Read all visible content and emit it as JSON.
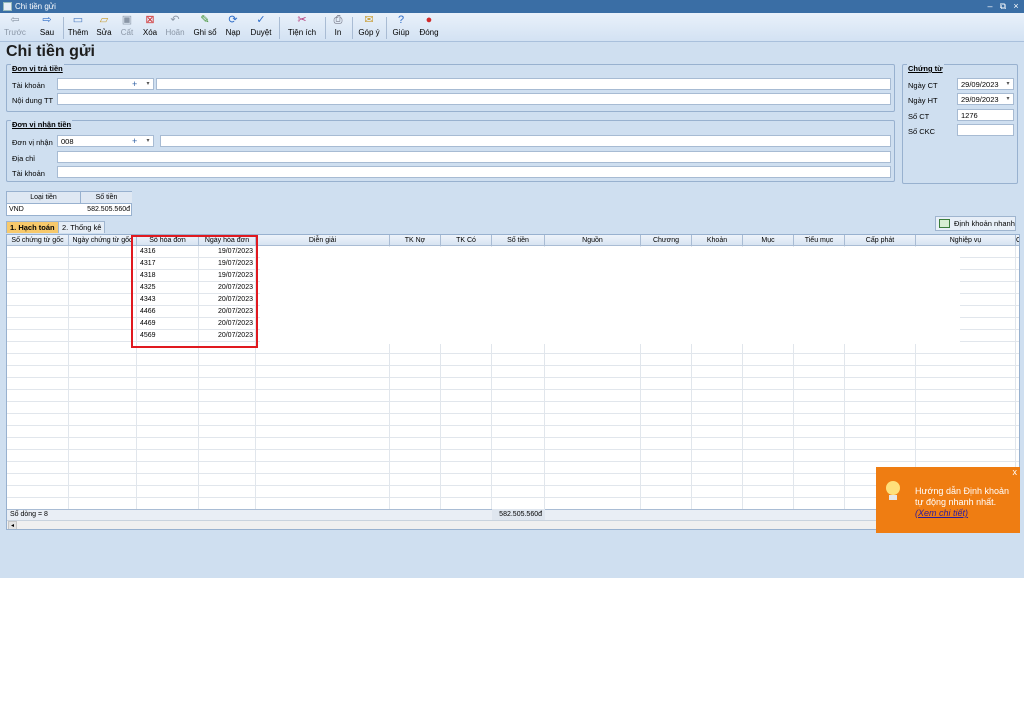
{
  "window": {
    "title": "Chi tiền gửi",
    "controls": [
      "–",
      "⧉",
      "×"
    ]
  },
  "toolbar": {
    "prev": "Trước",
    "next": "Sau",
    "add": "Thêm",
    "edit": "Sửa",
    "save": "Cất",
    "delete": "Xóa",
    "undo": "Hoãn",
    "post": "Ghi sổ",
    "load": "Nạp",
    "approve": "Duyệt",
    "utilities": "Tiện ích",
    "print": "In",
    "feedback": "Góp ý",
    "help": "Giúp",
    "close": "Đóng"
  },
  "page_title": "Chi tiền gửi",
  "payer": {
    "group_title": "Đơn vị trả tiền",
    "account_label": "Tài khoản",
    "content_label": "Nội dung TT"
  },
  "payee": {
    "group_title": "Đơn vị nhận tiền",
    "unit_label": "Đơn vị nhận",
    "unit_value": "008",
    "address_label": "Địa chỉ",
    "account_label": "Tài khoản"
  },
  "voucher": {
    "group_title": "Chứng từ",
    "date_ct_label": "Ngày CT",
    "date_ct": "29/09/2023",
    "date_ht_label": "Ngày HT",
    "date_ht": "29/09/2023",
    "number_label": "Số CT",
    "number": "1276",
    "ckc_label": "Số CKC",
    "ckc": ""
  },
  "currency_table": {
    "headers": [
      "Loại tiền",
      "Số tiền"
    ],
    "row": [
      "VND",
      "582.505.560đ"
    ]
  },
  "tabs": [
    "1. Hạch toán",
    "2. Thống kê"
  ],
  "quick_button": "Định khoản nhanh",
  "grid": {
    "headers": [
      "Số chứng từ gốc",
      "Ngày chứng từ gốc",
      "Số hóa đơn",
      "Ngày hóa đơn",
      "Diễn giải",
      "TK Nợ",
      "TK Có",
      "Số tiền",
      "Nguồn",
      "Chương",
      "Khoản",
      "Mục",
      "Tiểu mục",
      "Cấp phát",
      "Nghiệp vụ",
      "C"
    ],
    "rows": [
      [
        "4316",
        "19/07/2023"
      ],
      [
        "4317",
        "19/07/2023"
      ],
      [
        "4318",
        "19/07/2023"
      ],
      [
        "4325",
        "20/07/2023"
      ],
      [
        "4343",
        "20/07/2023"
      ],
      [
        "4466",
        "20/07/2023"
      ],
      [
        "4469",
        "20/07/2023"
      ],
      [
        "4569",
        "20/07/2023"
      ]
    ],
    "footer_count": "Số dòng = 8",
    "footer_total": "582.505.560đ"
  },
  "notification": {
    "line1": "Hướng dẫn Định khoản",
    "line2": "tự động nhanh nhất.",
    "link": "(Xem chi tiết)",
    "close": "x"
  }
}
